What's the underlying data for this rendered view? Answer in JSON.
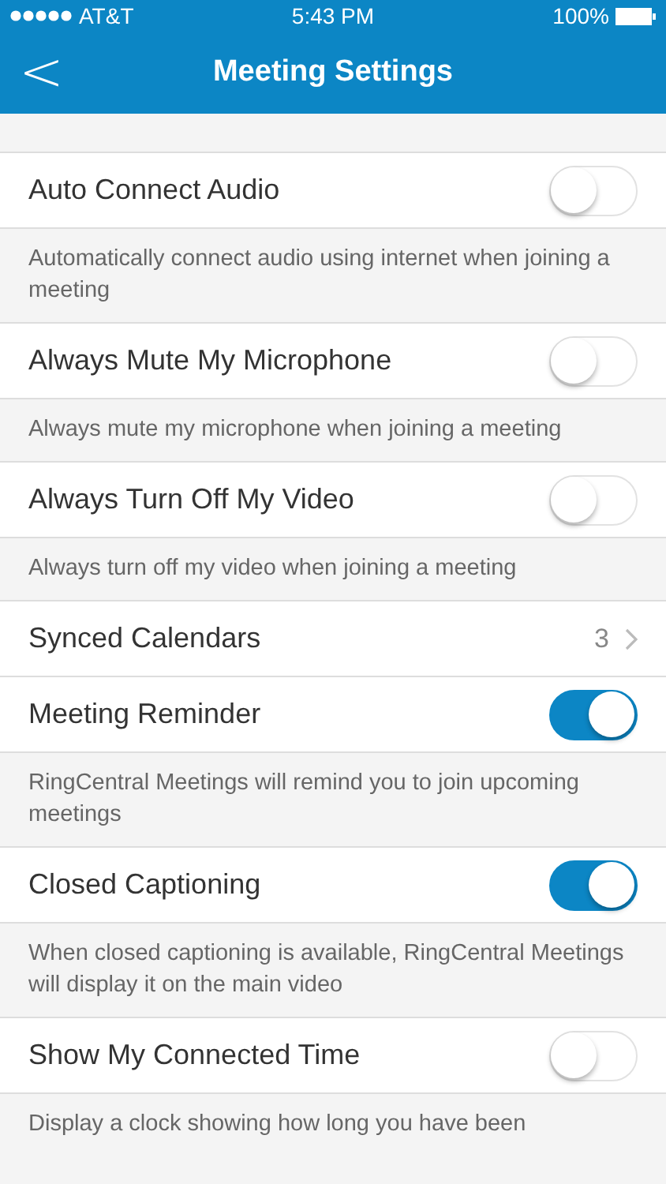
{
  "status_bar": {
    "carrier": "AT&T",
    "time": "5:43 PM",
    "battery": "100%"
  },
  "nav_bar": {
    "back": "<",
    "title": "Meeting Settings"
  },
  "settings": [
    {
      "kind": "toggle",
      "label": "Auto Connect Audio",
      "on": false,
      "description": "Automatically connect audio using internet when joining a meeting"
    },
    {
      "kind": "toggle",
      "label": "Always Mute My Microphone",
      "on": false,
      "description": "Always mute my microphone when joining a meeting"
    },
    {
      "kind": "toggle",
      "label": "Always Turn Off My Video",
      "on": false,
      "description": "Always turn off my video when joining a meeting"
    },
    {
      "kind": "link",
      "label": "Synced Calendars",
      "value": "3"
    },
    {
      "kind": "toggle",
      "label": "Meeting Reminder",
      "on": true,
      "description": "RingCentral Meetings will remind you to join upcoming meetings"
    },
    {
      "kind": "toggle",
      "label": "Closed Captioning",
      "on": true,
      "description": "When closed captioning is available, RingCentral Meetings will display it on the main video"
    },
    {
      "kind": "toggle",
      "label": "Show My Connected Time",
      "on": false,
      "description": "Display a clock showing how long you have been"
    }
  ]
}
